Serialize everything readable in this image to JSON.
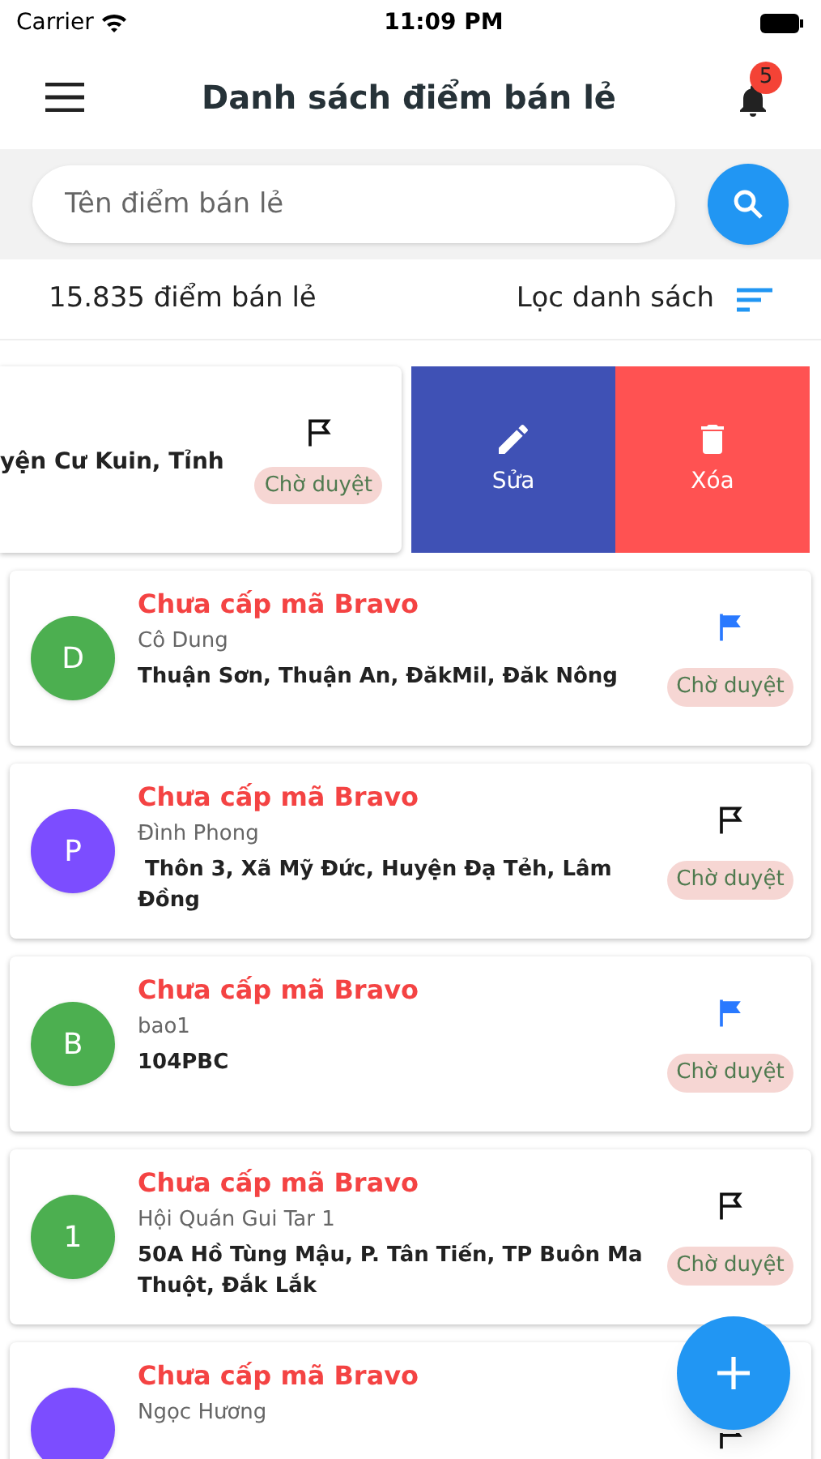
{
  "status_bar": {
    "carrier": "Carrier",
    "time": "11:09 PM"
  },
  "header": {
    "title": "Danh sách điểm bán lẻ",
    "notification_count": "5"
  },
  "search": {
    "placeholder": "Tên điểm bán lẻ"
  },
  "summary": {
    "count": "15.835 điểm bán lẻ",
    "filter_label": "Lọc danh sách"
  },
  "swiped_item": {
    "address": "yện Cư Kuin, Tỉnh",
    "flagged": false,
    "status": "Chờ duyệt",
    "actions": [
      {
        "kind": "edit",
        "label": "Sửa"
      },
      {
        "kind": "delete",
        "label": "Xóa"
      }
    ]
  },
  "items": [
    {
      "avatar": "D",
      "color": "#4caf50",
      "code_status": "Chưa cấp mã Bravo",
      "name": "Cô Dung",
      "address": "Thuận Sơn, Thuận An, ĐăkMil, Đăk Nông",
      "flagged": true,
      "status": "Chờ duyệt"
    },
    {
      "avatar": "P",
      "color": "#7c4dff",
      "code_status": "Chưa cấp mã Bravo",
      "name": "Đình Phong",
      "address": " Thôn 3, Xã Mỹ Đức, Huyện Đạ Tẻh, Lâm Đồng",
      "flagged": false,
      "status": "Chờ duyệt"
    },
    {
      "avatar": "B",
      "color": "#4caf50",
      "code_status": "Chưa cấp mã Bravo",
      "name": "bao1",
      "address": "104PBC",
      "flagged": true,
      "status": "Chờ duyệt"
    },
    {
      "avatar": "1",
      "color": "#4caf50",
      "code_status": "Chưa cấp mã Bravo",
      "name": "Hội Quán Gui Tar 1",
      "address": "50A Hồ Tùng Mậu, P. Tân Tiến, TP Buôn Ma Thuột, Đắk Lắk",
      "flagged": false,
      "status": "Chờ duyệt"
    },
    {
      "color": "#7c4dff",
      "code_status": "Chưa cấp mã Bravo",
      "name": "Ngọc Hương",
      "flagged": false
    }
  ]
}
